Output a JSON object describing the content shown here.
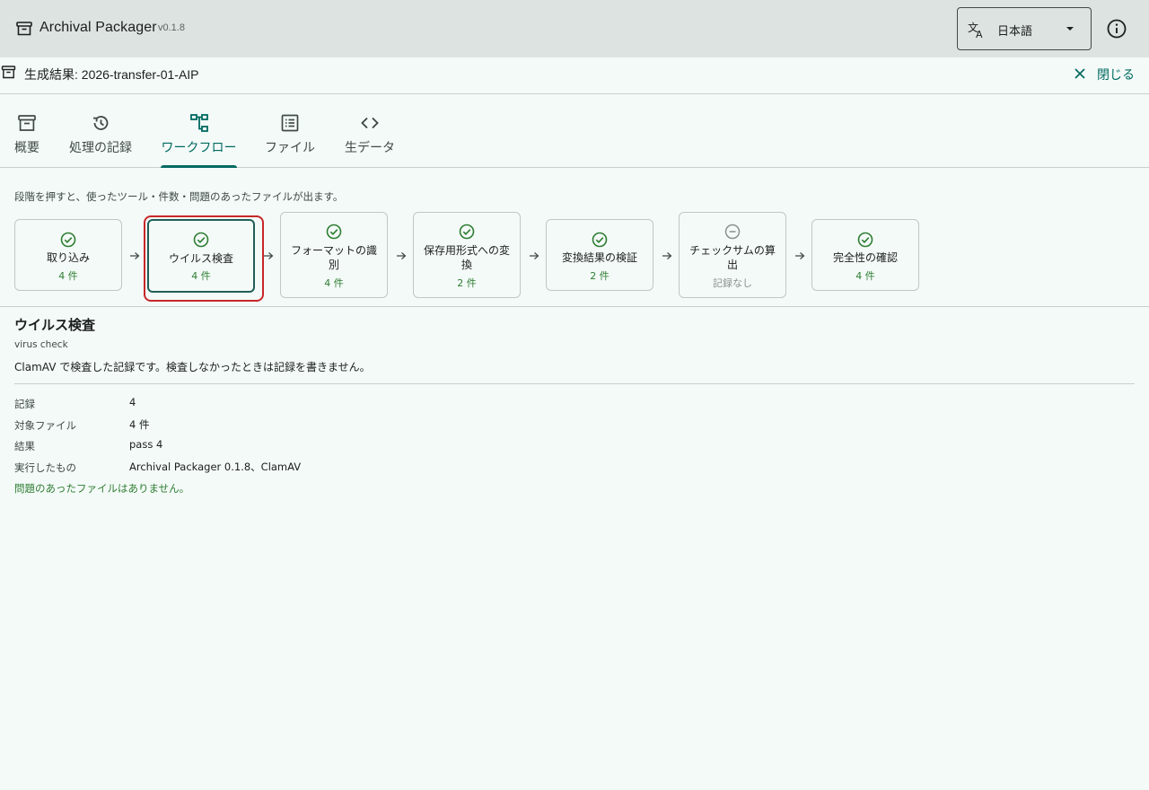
{
  "app": {
    "title": "Archival Packager",
    "version": "v0.1.8",
    "language": "日本語",
    "icons": {
      "logo": "archive-box-icon",
      "translate": "translate-icon",
      "info": "info-icon"
    }
  },
  "result": {
    "title": "生成結果: 2026-transfer-01-AIP",
    "close_label": "閉じる"
  },
  "tabs": [
    {
      "label": "概要",
      "icon": "archive-icon",
      "active": false
    },
    {
      "label": "処理の記録",
      "icon": "history-icon",
      "active": false
    },
    {
      "label": "ワークフロー",
      "icon": "workflow-icon",
      "active": true
    },
    {
      "label": "ファイル",
      "icon": "list-icon",
      "active": false
    },
    {
      "label": "生データ",
      "icon": "code-icon",
      "active": false
    }
  ],
  "workflow": {
    "hint": "段階を押すと、使ったツール・件数・問題のあったファイルが出ます。",
    "stages": [
      {
        "name": "取り込み",
        "count": "4 件",
        "status": "ok"
      },
      {
        "name": "ウイルス検査",
        "count": "4 件",
        "status": "ok"
      },
      {
        "name": "フォーマットの識別",
        "count": "4 件",
        "status": "ok"
      },
      {
        "name": "保存用形式への変換",
        "count": "2 件",
        "status": "ok"
      },
      {
        "name": "変換結果の検証",
        "count": "2 件",
        "status": "ok"
      },
      {
        "name": "チェックサムの算出",
        "count": "記録なし",
        "status": "none"
      },
      {
        "name": "完全性の確認",
        "count": "4 件",
        "status": "ok"
      }
    ]
  },
  "detail": {
    "title": "ウイルス検査",
    "subtitle": "virus check",
    "description": "ClamAV で検査した記録です。検査しなかったときは記録を書きません。",
    "rows": [
      {
        "key": "記録",
        "value": "4"
      },
      {
        "key": "対象ファイル",
        "value": "4 件"
      },
      {
        "key": "結果",
        "value": "pass 4"
      },
      {
        "key": "実行したもの",
        "value": "Archival Packager 0.1.8、ClamAV"
      }
    ],
    "note": "問題のあったファイルはありません。"
  },
  "colors": {
    "accent": "#006a60",
    "ok": "#2e7d32",
    "selection": "#c62828",
    "appbar": "#dde3e1",
    "background": "#f4faf8"
  }
}
